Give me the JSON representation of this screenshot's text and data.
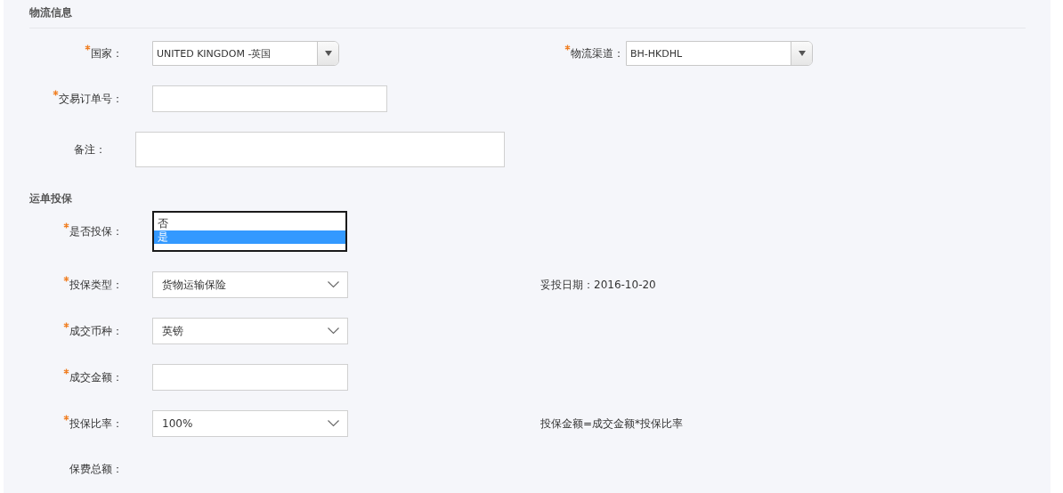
{
  "sections": [
    {
      "title": "物流信息",
      "divider": true,
      "rows": [
        {
          "fields": [
            {
              "kind": "classic-select",
              "label": "国家：",
              "required": true,
              "value": "UNITED KINGDOM -英国"
            },
            {
              "kind": "classic-select",
              "label": "物流渠道：",
              "required": true,
              "value": "BH-HKDHL"
            }
          ]
        },
        {
          "fields": [
            {
              "kind": "input",
              "label": "交易订单号：",
              "required": true
            }
          ]
        },
        {
          "fields": [
            {
              "kind": "textarea",
              "label": "备注：",
              "required": false
            }
          ]
        }
      ]
    },
    {
      "title": "运单投保",
      "divider": false,
      "rows": [
        {
          "fields": [
            {
              "kind": "listbox",
              "label": "是否投保：",
              "required": true,
              "options": [
                {
                  "label": "否",
                  "selected": false
                },
                {
                  "label": "是",
                  "selected": true
                }
              ]
            }
          ]
        },
        {
          "fields": [
            {
              "kind": "select",
              "label": "投保类型：",
              "required": true,
              "value": "货物运输保险"
            },
            {
              "kind": "note",
              "text": "妥投日期：2016-10-20"
            }
          ]
        },
        {
          "fields": [
            {
              "kind": "select",
              "label": "成交币种：",
              "required": true,
              "value": "英镑"
            }
          ]
        },
        {
          "fields": [
            {
              "kind": "input",
              "label": "成交金额：",
              "required": true
            }
          ]
        },
        {
          "fields": [
            {
              "kind": "select",
              "label": "投保比率：",
              "required": true,
              "value": "100%"
            },
            {
              "kind": "note",
              "text": "投保金额=成交金额*投保比率"
            }
          ]
        },
        {
          "fields": [
            {
              "kind": "none",
              "label": "保费总额：",
              "required": false
            }
          ]
        }
      ]
    }
  ]
}
